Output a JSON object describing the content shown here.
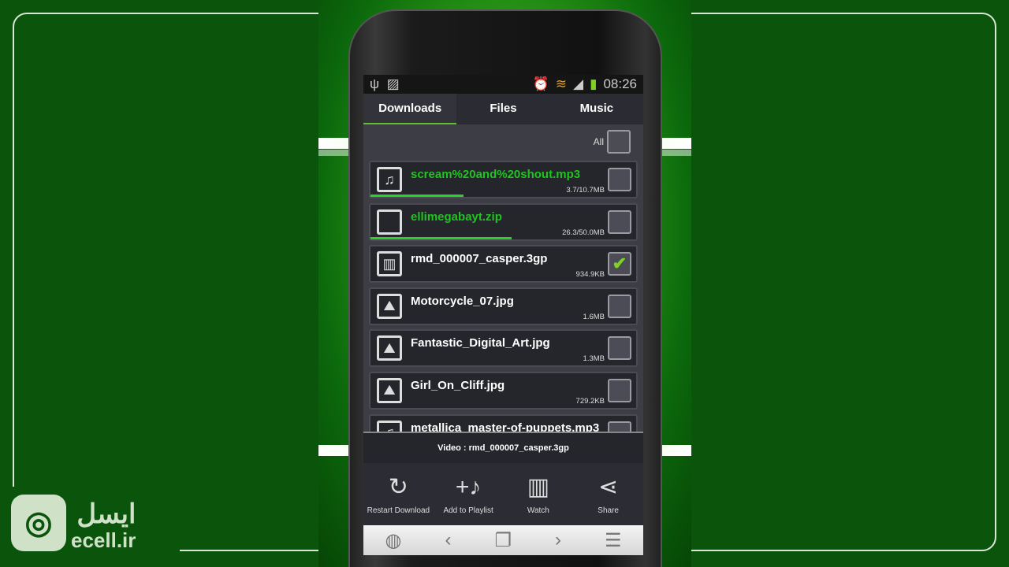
{
  "status_bar": {
    "time": "08:26",
    "icons": [
      "usb-icon",
      "image-icon",
      "alarm-icon",
      "wifi-icon",
      "signal-icon",
      "battery-charging-icon"
    ]
  },
  "tabs": [
    {
      "label": "Downloads",
      "active": true
    },
    {
      "label": "Files"
    },
    {
      "label": "Music"
    }
  ],
  "select_all": {
    "label": "All",
    "checked": false
  },
  "files": [
    {
      "name": "scream%20and%20shout.mp3",
      "size": "3.7/10.7MB",
      "icon": "music-note-icon",
      "downloading": true,
      "progress": 0.35,
      "checked": false
    },
    {
      "name": "ellimegabayt.zip",
      "size": "26.3/50.0MB",
      "icon": "blank-file-icon",
      "downloading": true,
      "progress": 0.53,
      "checked": false
    },
    {
      "name": "rmd_000007_casper.3gp",
      "size": "934.9KB",
      "icon": "film-icon",
      "checked": true
    },
    {
      "name": "Motorcycle_07.jpg",
      "size": "1.6MB",
      "icon": "image-icon",
      "checked": false
    },
    {
      "name": "Fantastic_Digital_Art.jpg",
      "size": "1.3MB",
      "icon": "image-icon",
      "checked": false
    },
    {
      "name": "Girl_On_Cliff.jpg",
      "size": "729.2KB",
      "icon": "image-icon",
      "checked": false
    },
    {
      "name": "metallica_master-of-puppets.mp3",
      "size": "",
      "icon": "music-note-icon",
      "checked": false
    }
  ],
  "popup": {
    "title": "Video : rmd_000007_casper.3gp",
    "actions": [
      {
        "label": "Restart Download",
        "icon": "restart-icon"
      },
      {
        "label": "Add to Playlist",
        "icon": "add-to-playlist-icon"
      },
      {
        "label": "Watch",
        "icon": "film-icon"
      },
      {
        "label": "Share",
        "icon": "share-icon"
      }
    ]
  },
  "nav_bar": [
    "globe-icon",
    "back-icon",
    "windows-icon",
    "forward-icon",
    "menu-icon"
  ],
  "logo": {
    "fa": "ایسل",
    "en": "ecell.ir"
  },
  "colors": {
    "accent": "#5ec02c",
    "downloading_text": "#1fc41f",
    "background": "#0b540b"
  }
}
